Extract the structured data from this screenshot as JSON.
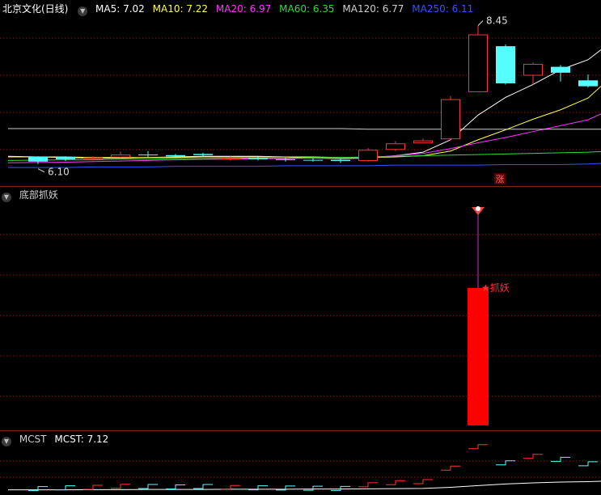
{
  "panel_main": {
    "title": "北京文化(日线)",
    "ma": [
      {
        "label": "MA5: 7.02",
        "color": "#ffffff"
      },
      {
        "label": "MA10: 7.22",
        "color": "#ffff4d"
      },
      {
        "label": "MA20: 6.97",
        "color": "#ff33ff"
      },
      {
        "label": "MA60: 6.35",
        "color": "#33dd33"
      },
      {
        "label": "MA120: 6.77",
        "color": "#d0d0d0"
      },
      {
        "label": "MA250: 6.11",
        "color": "#3355ff"
      }
    ],
    "high_label": "8.45",
    "low_label": "6.10",
    "limit_up_badge": "涨"
  },
  "panel_indicator": {
    "title": "底部抓妖",
    "signal_label": "★抓妖"
  },
  "panel_mcst": {
    "title": "MCST",
    "value_label": "MCST: 7.12"
  },
  "colors": {
    "up": "#ff3333",
    "down": "#55ffff",
    "grid": "#8b1a1a",
    "signal_bar": "#ff0000",
    "signal_line": "#cc33cc"
  },
  "chart_data": [
    {
      "type": "candlestick",
      "title": "北京文化(日线)",
      "x": [
        1,
        2,
        3,
        4,
        5,
        6,
        7,
        8,
        9,
        10,
        11,
        12,
        13,
        14,
        15,
        16,
        17,
        18,
        19,
        20,
        21
      ],
      "open": [
        6.22,
        6.22,
        6.19,
        6.21,
        6.26,
        6.25,
        6.27,
        6.19,
        6.2,
        6.18,
        6.17,
        6.17,
        6.15,
        6.34,
        6.45,
        6.52,
        7.32,
        8.1,
        7.6,
        7.75,
        7.52
      ],
      "close": [
        6.14,
        6.18,
        6.21,
        6.26,
        6.25,
        6.23,
        6.25,
        6.2,
        6.18,
        6.17,
        6.16,
        6.15,
        6.34,
        6.45,
        6.5,
        7.2,
        8.3,
        7.47,
        7.8,
        7.65,
        7.42
      ],
      "high": [
        6.23,
        6.23,
        6.23,
        6.31,
        6.32,
        6.27,
        6.29,
        6.23,
        6.22,
        6.21,
        6.2,
        6.19,
        6.37,
        6.49,
        6.53,
        7.25,
        8.45,
        8.13,
        7.82,
        7.78,
        7.62
      ],
      "low": [
        6.1,
        6.15,
        6.16,
        6.2,
        6.22,
        6.22,
        6.22,
        6.16,
        6.16,
        6.14,
        6.14,
        6.12,
        6.14,
        6.32,
        6.45,
        6.5,
        7.32,
        7.45,
        7.45,
        7.5,
        7.4
      ],
      "ma_series": [
        {
          "name": "MA5",
          "last": 7.02,
          "values": [
            6.23,
            6.21,
            6.2,
            6.2,
            6.21,
            6.22,
            6.23,
            6.23,
            6.23,
            6.22,
            6.2,
            6.19,
            6.2,
            6.24,
            6.3,
            6.51,
            6.93,
            7.23,
            7.45,
            7.7,
            7.87
          ]
        },
        {
          "name": "MA10",
          "last": 7.22,
          "values": [
            6.22,
            6.22,
            6.21,
            6.21,
            6.21,
            6.21,
            6.22,
            6.22,
            6.22,
            6.22,
            6.22,
            6.21,
            6.21,
            6.22,
            6.24,
            6.32,
            6.51,
            6.68,
            6.86,
            7.02,
            7.22
          ]
        },
        {
          "name": "MA20",
          "last": 6.97,
          "values": [
            6.12,
            6.13,
            6.14,
            6.15,
            6.16,
            6.17,
            6.18,
            6.18,
            6.19,
            6.19,
            6.2,
            6.2,
            6.21,
            6.24,
            6.28,
            6.36,
            6.46,
            6.55,
            6.65,
            6.75,
            6.85
          ]
        },
        {
          "name": "MA60",
          "last": 6.35,
          "values": [
            6.16,
            6.17,
            6.17,
            6.18,
            6.18,
            6.19,
            6.19,
            6.2,
            6.2,
            6.2,
            6.21,
            6.21,
            6.22,
            6.23,
            6.24,
            6.25,
            6.26,
            6.27,
            6.28,
            6.29,
            6.3
          ]
        },
        {
          "name": "MA120",
          "last": 6.77,
          "values": [
            6.7,
            6.7,
            6.7,
            6.7,
            6.7,
            6.7,
            6.7,
            6.7,
            6.7,
            6.7,
            6.7,
            6.7,
            6.69,
            6.69,
            6.69,
            6.69,
            6.69,
            6.69,
            6.69,
            6.69,
            6.69
          ]
        },
        {
          "name": "MA250",
          "last": 6.11,
          "values": [
            6.04,
            6.04,
            6.05,
            6.05,
            6.05,
            6.06,
            6.06,
            6.06,
            6.06,
            6.07,
            6.07,
            6.07,
            6.07,
            6.08,
            6.08,
            6.08,
            6.08,
            6.09,
            6.09,
            6.09,
            6.1
          ]
        }
      ],
      "annotations": [
        {
          "text": "8.45",
          "x": 17,
          "y": 8.45
        },
        {
          "text": "6.10",
          "x": 1,
          "y": 6.1
        },
        {
          "text": "涨",
          "x": 17
        }
      ]
    },
    {
      "type": "bar",
      "title": "底部抓妖",
      "x": [
        17
      ],
      "values": [
        1
      ],
      "annotations": [
        {
          "text": "★抓妖",
          "x": 17
        }
      ]
    },
    {
      "type": "line",
      "title": "MCST",
      "series": [
        {
          "name": "MCST",
          "last": 7.12,
          "values": [
            6.1,
            6.1,
            6.11,
            6.11,
            6.12,
            6.12,
            6.12,
            6.13,
            6.13,
            6.13,
            6.14,
            6.14,
            6.15,
            6.16,
            6.17,
            6.23,
            6.32,
            6.4,
            6.46,
            6.5,
            6.52
          ]
        }
      ]
    }
  ]
}
